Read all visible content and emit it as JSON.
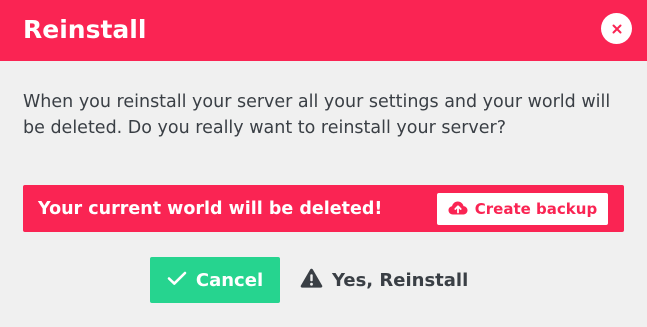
{
  "dialog": {
    "title": "Reinstall",
    "message": "When you reinstall your server all your settings and your world will be deleted. Do you really want to reinstall your server?",
    "warning": {
      "text": "Your current world will be deleted!",
      "backup_label": "Create backup"
    },
    "actions": {
      "cancel_label": "Cancel",
      "confirm_label": "Yes, Reinstall"
    }
  },
  "icons": {
    "close": "close-icon",
    "backup": "cloud-upload-icon",
    "cancel": "check-icon",
    "confirm": "warning-triangle-icon"
  },
  "colors": {
    "accent": "#fa2453",
    "success": "#26d48f",
    "background": "#f0f0f0",
    "text": "#3a3f45"
  }
}
